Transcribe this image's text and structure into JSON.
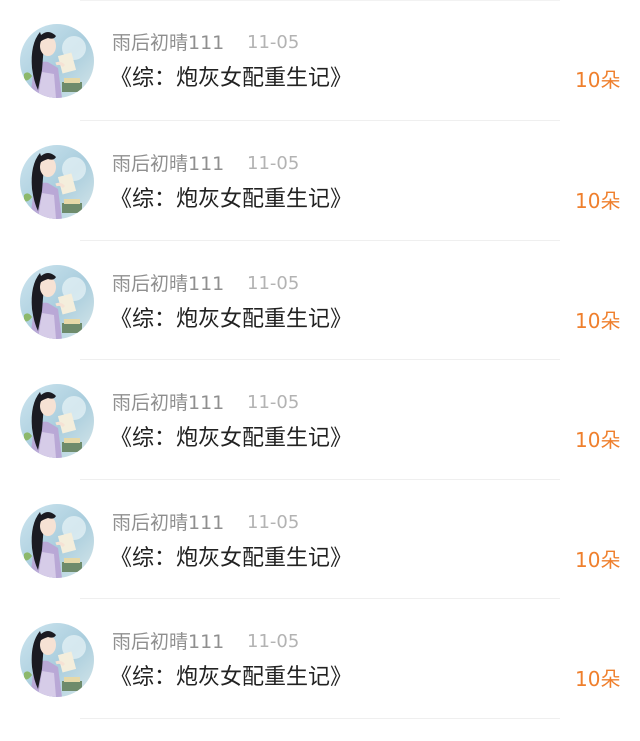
{
  "rows": [
    {
      "name": "雨后初晴111",
      "date": "11-05",
      "title": "《综：炮灰女配重生记》",
      "count": "10朵",
      "avatar": "avatar-icon"
    },
    {
      "name": "雨后初晴111",
      "date": "11-05",
      "title": "《综：炮灰女配重生记》",
      "count": "10朵",
      "avatar": "avatar-icon"
    },
    {
      "name": "雨后初晴111",
      "date": "11-05",
      "title": "《综：炮灰女配重生记》",
      "count": "10朵",
      "avatar": "avatar-icon"
    },
    {
      "name": "雨后初晴111",
      "date": "11-05",
      "title": "《综：炮灰女配重生记》",
      "count": "10朵",
      "avatar": "avatar-icon"
    },
    {
      "name": "雨后初晴111",
      "date": "11-05",
      "title": "《综：炮灰女配重生记》",
      "count": "10朵",
      "avatar": "avatar-icon"
    },
    {
      "name": "雨后初晴111",
      "date": "11-05",
      "title": "《综：炮灰女配重生记》",
      "count": "10朵",
      "avatar": "avatar-icon"
    }
  ],
  "colors": {
    "name": "#8f8f8f",
    "date": "#b3b3b3",
    "title": "#222222",
    "count": "#ef7f2c",
    "separator": "#efefef"
  }
}
